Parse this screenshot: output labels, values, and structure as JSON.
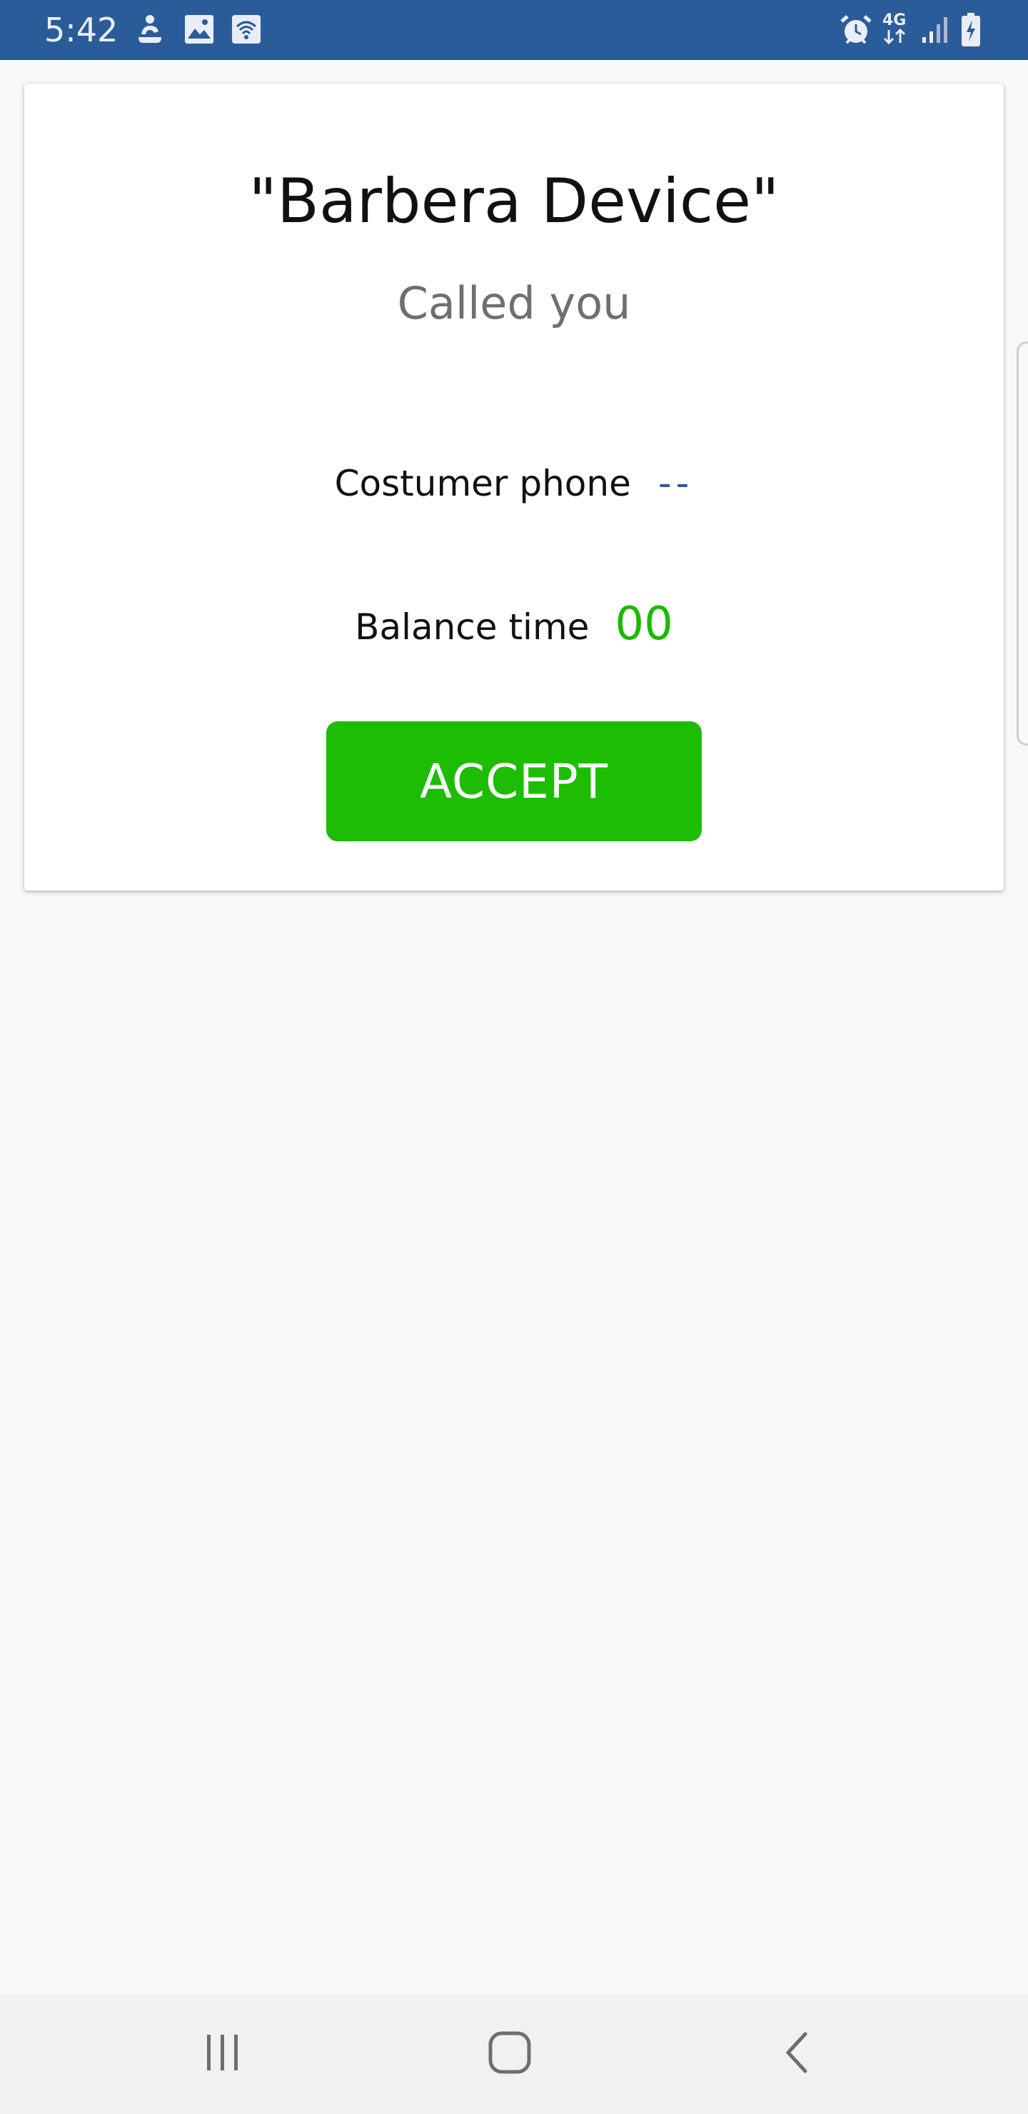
{
  "status_bar": {
    "time": "5:42",
    "left_icons": [
      "accessibility-icon",
      "image-icon",
      "wifi-hotspot-icon"
    ],
    "right_icons": [
      "alarm-icon",
      "network-4g-icon",
      "signal-icon",
      "battery-charging-icon"
    ],
    "network_label": "4G",
    "background_color": "#2b5c9a"
  },
  "call_card": {
    "title": "\"Barbera Device\"",
    "subtitle": "Called you",
    "phone_label": "Costumer phone",
    "phone_value": "--",
    "balance_label": "Balance time",
    "balance_value": "00",
    "accept_label": "ACCEPT",
    "accent_color": "#1dbd04"
  },
  "navigation_bar": {
    "buttons": [
      "recent-apps-icon",
      "home-icon",
      "back-icon"
    ]
  }
}
